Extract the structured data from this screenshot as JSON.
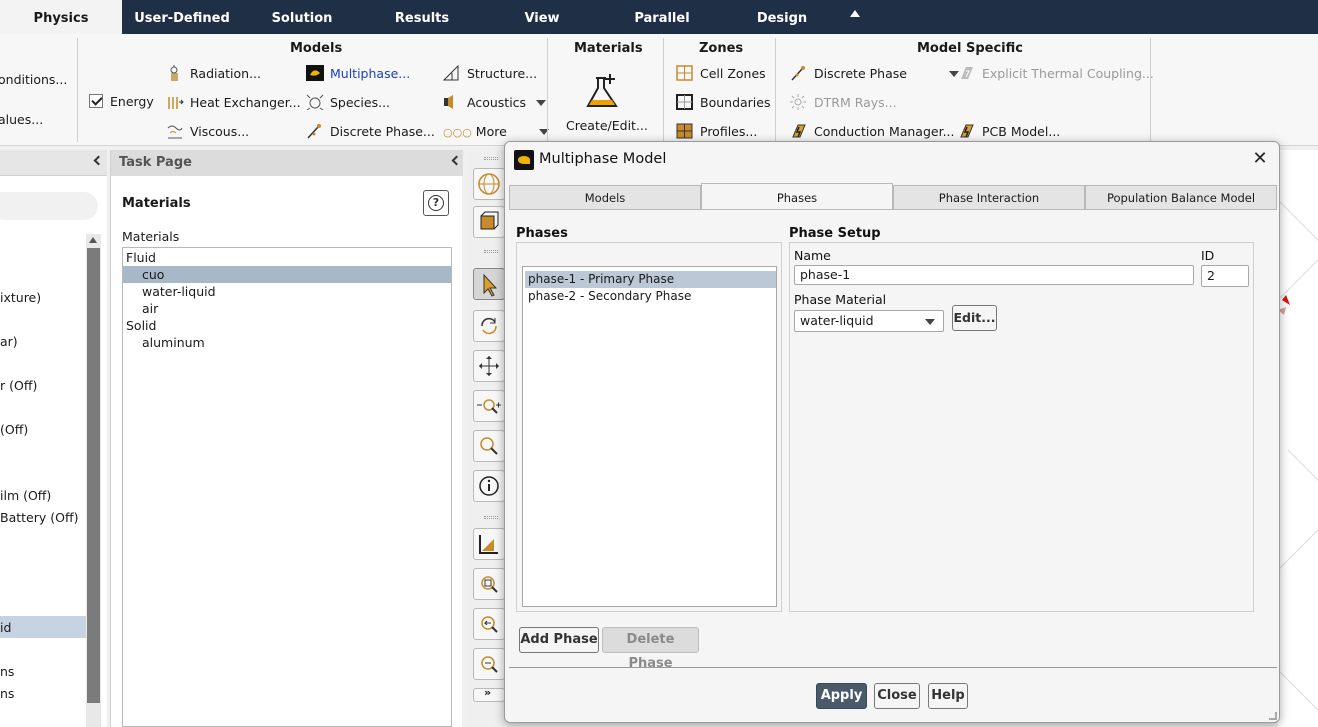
{
  "ribbon_tabs": [
    {
      "label": "Physics",
      "active": true
    },
    {
      "label": "User-Defined"
    },
    {
      "label": "Solution"
    },
    {
      "label": "Results"
    },
    {
      "label": "View"
    },
    {
      "label": "Parallel"
    },
    {
      "label": "Design"
    }
  ],
  "ribbon": {
    "left_partial": {
      "conditions": "onditions...",
      "values": "alues..."
    },
    "models": {
      "title": "Models",
      "energy": "Energy",
      "radiation": "Radiation...",
      "heat_exchanger": "Heat Exchanger...",
      "viscous": "Viscous...",
      "multiphase": "Multiphase...",
      "species": "Species...",
      "discrete_phase": "Discrete Phase...",
      "structure": "Structure...",
      "acoustics": "Acoustics",
      "more": "More"
    },
    "materials": {
      "title": "Materials",
      "create_edit": "Create/Edit..."
    },
    "zones": {
      "title": "Zones",
      "cell_zones": "Cell Zones",
      "boundaries": "Boundaries",
      "profiles": "Profiles..."
    },
    "model_specific": {
      "title": "Model Specific",
      "discrete_phase": "Discrete Phase",
      "explicit_thermal": "Explicit Thermal Coupling...",
      "dtrm_rays": "DTRM Rays...",
      "conduction_manager": "Conduction Manager...",
      "pcb_model": "PCB Model..."
    }
  },
  "outline": {
    "items": [
      "ixture)",
      "ar)",
      "r (Off)",
      "(Off)",
      "ilm (Off)",
      "Battery (Off)",
      "id",
      "ns",
      "ns"
    ]
  },
  "task_page": {
    "header": "Task Page",
    "title": "Materials",
    "list_label": "Materials",
    "list": [
      {
        "label": "Fluid",
        "indent": false,
        "selected": false
      },
      {
        "label": "cuo",
        "indent": true,
        "selected": true
      },
      {
        "label": "water-liquid",
        "indent": true,
        "selected": false
      },
      {
        "label": "air",
        "indent": true,
        "selected": false
      },
      {
        "label": "Solid",
        "indent": false,
        "selected": false
      },
      {
        "label": "aluminum",
        "indent": true,
        "selected": false
      }
    ]
  },
  "dialog": {
    "title": "Multiphase Model",
    "tabs": [
      {
        "label": "Models"
      },
      {
        "label": "Phases",
        "active": true
      },
      {
        "label": "Phase Interaction"
      },
      {
        "label": "Population Balance Model"
      }
    ],
    "phases_title": "Phases",
    "phases": [
      {
        "label": "phase-1 - Primary Phase",
        "selected": true
      },
      {
        "label": "phase-2 - Secondary Phase",
        "selected": false
      }
    ],
    "phase_setup_title": "Phase Setup",
    "name_label": "Name",
    "name_value": "phase-1",
    "id_label": "ID",
    "id_value": "2",
    "phase_material_label": "Phase Material",
    "phase_material_value": "water-liquid",
    "edit_label": "Edit...",
    "add_phase": "Add Phase",
    "delete_phase": "Delete Phase",
    "apply": "Apply",
    "close": "Close",
    "help": "Help"
  },
  "colors": {
    "tabbar": "#1f2f45",
    "link": "#1c3fbd",
    "apply": "#4b5a6b"
  }
}
